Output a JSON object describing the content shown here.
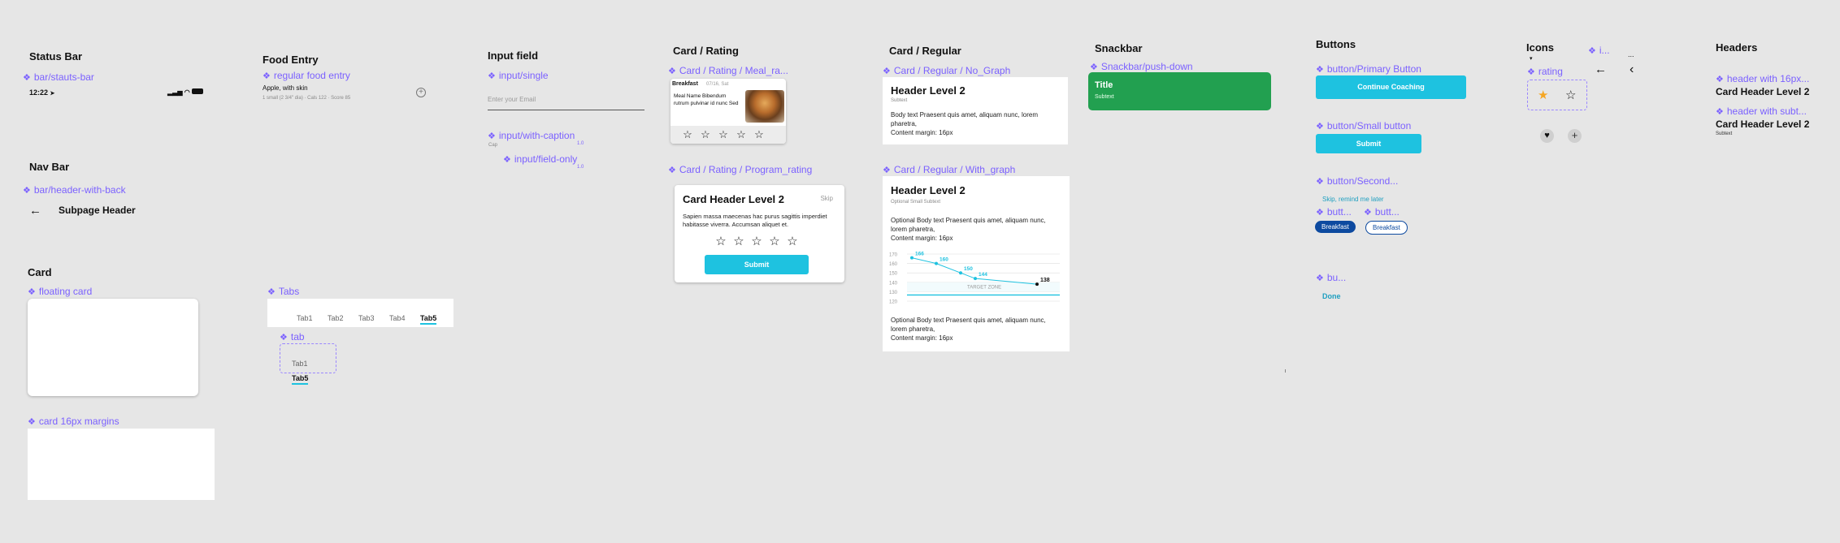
{
  "status_bar": {
    "title": "Status Bar",
    "component": "bar/stauts-bar",
    "time": "12:22"
  },
  "nav_bar": {
    "title": "Nav Bar",
    "component": "bar/header-with-back",
    "back_arrow": "←",
    "header": "Subpage Header"
  },
  "card": {
    "title": "Card",
    "floating_component": "floating card",
    "margins_component": "card 16px margins"
  },
  "food_entry": {
    "title": "Food Entry",
    "component": "regular food entry",
    "name": "Apple, with skin",
    "detail": "1 small (2 3/4\" dia) · Cals 122 · Score 85"
  },
  "tabs": {
    "component": "Tabs",
    "items": [
      "Tab1",
      "Tab2",
      "Tab3",
      "Tab4",
      "Tab5"
    ],
    "tab_component": "tab",
    "small_items": [
      "Tab1",
      "Tab5"
    ]
  },
  "input_field": {
    "title": "Input field",
    "single_component": "input/single",
    "placeholder": "Enter your Email",
    "caption_component": "input/with-caption",
    "caption_left": "Cap",
    "caption_right": "1.0",
    "field_only_component": "input/field-only",
    "field_only_right": "1.0"
  },
  "card_rating": {
    "title": "Card / Rating",
    "meal_component": "Card / Rating / Meal_ra...",
    "meal_label": "Breakfast",
    "meal_date": "07/16, Sat",
    "meal_text": "Meal Name Bibendum rutrum pulvinar id nunc Sed",
    "program_component": "Card / Rating / Program_rating",
    "program_header": "Card Header Level 2",
    "skip": "Skip",
    "program_body": "Sapien massa maecenas hac purus sagittis imperdiet habitasse viverra. Accumsan aliquet et.",
    "submit": "Submit",
    "star": "☆"
  },
  "card_regular": {
    "title": "Card / Regular",
    "no_graph_component": "Card / Regular / No_Graph",
    "header": "Header Level 2",
    "subtext": "Subtext",
    "body": "Body text Praesent quis amet, aliquam nunc, lorem pharetra,",
    "margin_note": "Content margin: 16px",
    "with_graph_component": "Card / Regular / With_graph",
    "graph_header": "Header Level 2",
    "graph_subtext": "Optional Small Subtext",
    "graph_body": "Optional Body text Praesent quis amet, aliquam nunc, lorem pharetra,",
    "graph_margin_note": "Content margin: 16px",
    "graph_body2": "Optional Body text Praesent quis amet, aliquam nunc, lorem pharetra,",
    "graph_margin_note2": "Content margin: 16px",
    "target_zone": "TARGET ZONE"
  },
  "chart_data": {
    "type": "line",
    "y_ticks": [
      "170",
      "160",
      "150",
      "140",
      "130",
      "120"
    ],
    "values": [
      166,
      160,
      150,
      144,
      138
    ],
    "labels": [
      "166",
      "160",
      "150",
      "144",
      "138"
    ],
    "ylim": [
      120,
      170
    ]
  },
  "snackbar": {
    "title": "Snackbar",
    "component": "Snackbar/push-down",
    "snack_title": "Title",
    "snack_subtext": "Subtext",
    "color": "#22a050"
  },
  "buttons": {
    "title": "Buttons",
    "primary_component": "button/Primary Button",
    "primary_label": "Continue Coaching",
    "small_component": "button/Small button",
    "small_label": "Submit",
    "secondary_component": "button/Second...",
    "secondary_link": "Skip, remind me later",
    "chip_comp_a": "butt...",
    "chip_comp_b": "butt...",
    "chip_filled": "Breakfast",
    "chip_outline": "Breakfast",
    "text_comp": "bu...",
    "done": "Done",
    "accent": "#1ec2e0"
  },
  "icons": {
    "title": "Icons",
    "rating_component": "rating",
    "i_component": "i...",
    "more": "...",
    "arrow_left": "←",
    "chevron_left": "‹"
  },
  "headers": {
    "title": "Headers",
    "comp_a": "header with 16px...",
    "header_a": "Card Header Level 2",
    "comp_b": "header with subt...",
    "header_b": "Card Header Level 2",
    "subtext_b": "Subtext"
  }
}
